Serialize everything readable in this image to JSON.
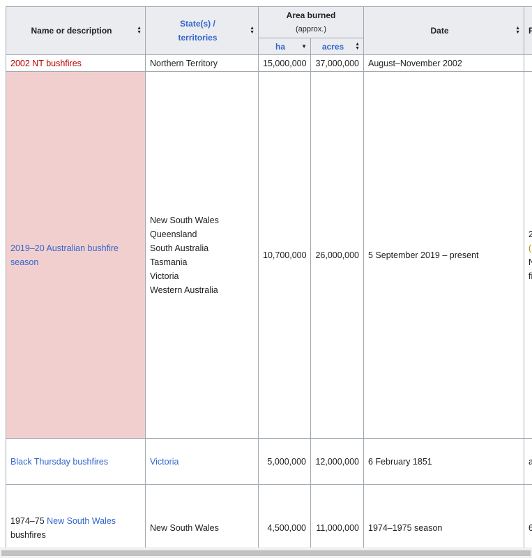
{
  "table": {
    "headers": {
      "name": "Name or description",
      "states": "State(s) /\nterritories",
      "area": "Area burned",
      "area_sub": "(approx.)",
      "ha": "ha",
      "acres": "acres",
      "date": "Date",
      "next_partial": "F"
    },
    "rows": [
      {
        "name": "2002 NT bushfires",
        "states": [
          "Northern Territory"
        ],
        "ha": "15,000,000",
        "acres": "37,000,000",
        "date": "August–November 2002",
        "extra": ""
      },
      {
        "name_line1": "2019–20 Australian bushfire",
        "name_line2": "season",
        "states": [
          "New South Wales",
          "Queensland",
          "South Australia",
          "Tasmania",
          "Victoria",
          "Western Australia"
        ],
        "ha": "10,700,000",
        "acres": "26,000,000",
        "date": "5 September 2019 – present",
        "extra": [
          "2",
          "(",
          "N",
          "fi"
        ]
      },
      {
        "name": "Black Thursday bushfires",
        "states": [
          "Victoria"
        ],
        "ha": "5,000,000",
        "acres": "12,000,000",
        "date": "6 February 1851",
        "extra": "a"
      },
      {
        "name_prefix": "1974–75",
        "name_link": "New South Wales",
        "name_suffix": "bushfires",
        "states": [
          "New South Wales"
        ],
        "ha": "4,500,000",
        "acres": "11,000,000",
        "date": "1974–1975 season",
        "extra": "6"
      }
    ]
  },
  "icons": {
    "sort_both": "sort-both-icon",
    "sort_down": "sort-down-icon"
  },
  "colors": {
    "header_bg": "#eaecf0",
    "border": "#a2a9b1",
    "link": "#3366cc",
    "redlink": "#ba0000",
    "highlight": "#f2cfcf"
  }
}
